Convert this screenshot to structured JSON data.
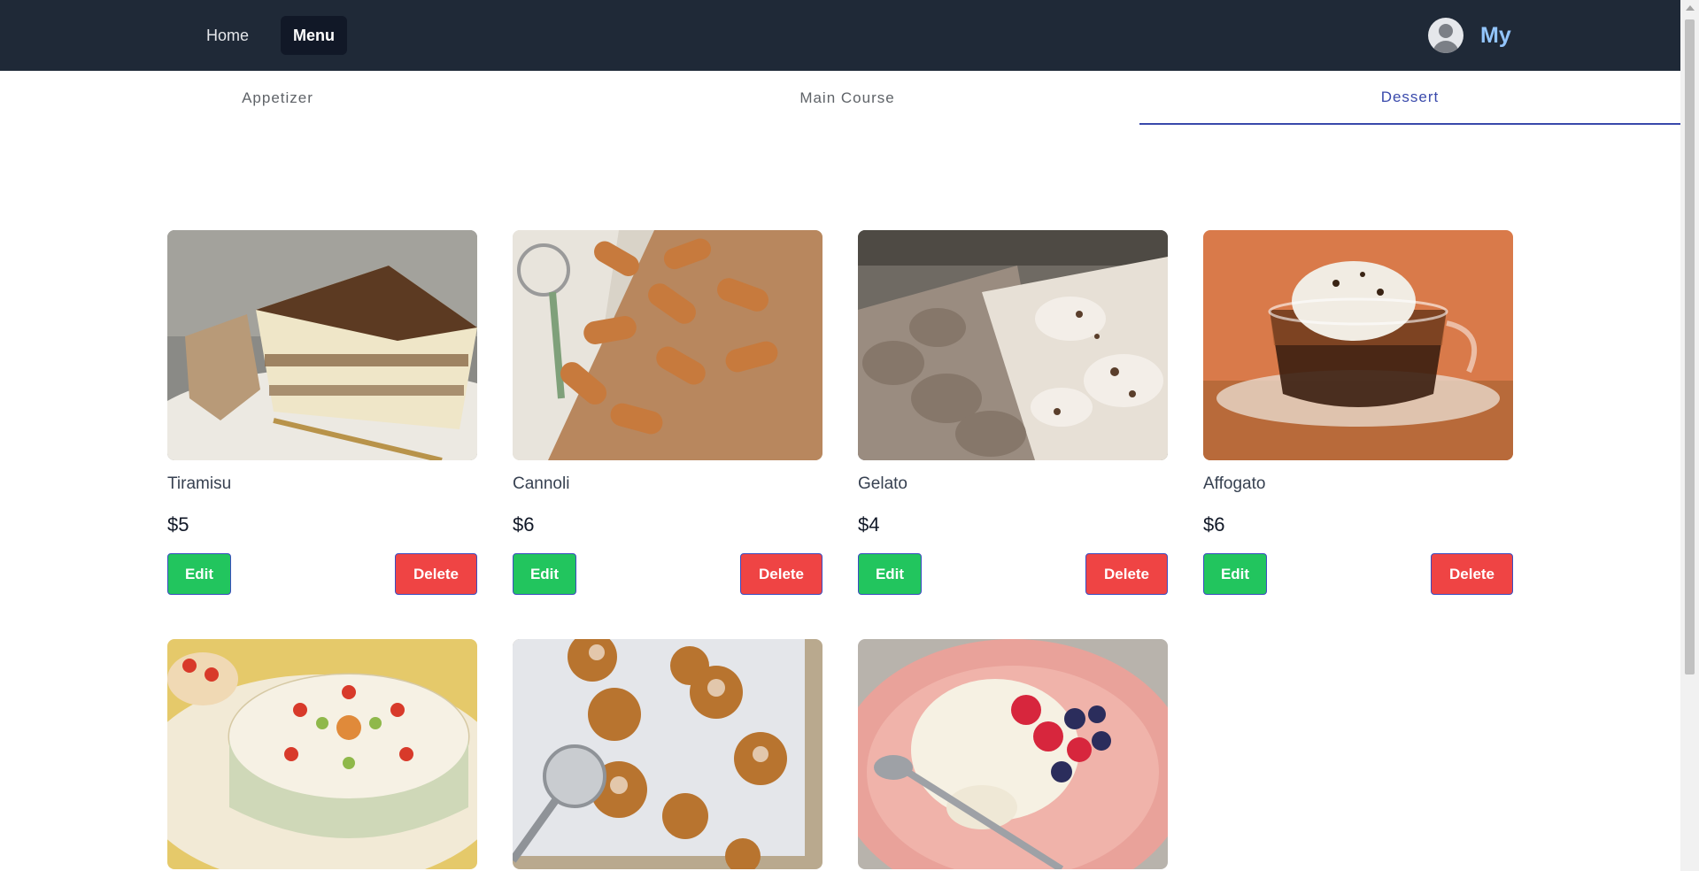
{
  "nav": {
    "home_label": "Home",
    "menu_label": "Menu",
    "user_label": "My"
  },
  "tabs": [
    {
      "label": "Appetizer"
    },
    {
      "label": "Main Course"
    },
    {
      "label": "Dessert",
      "active": true
    }
  ],
  "items": [
    {
      "name": "Tiramisu",
      "price": "$5",
      "edit_label": "Edit",
      "delete_label": "Delete",
      "image": "tiramisu"
    },
    {
      "name": "Cannoli",
      "price": "$6",
      "edit_label": "Edit",
      "delete_label": "Delete",
      "image": "cannoli"
    },
    {
      "name": "Gelato",
      "price": "$4",
      "edit_label": "Edit",
      "delete_label": "Delete",
      "image": "gelato"
    },
    {
      "name": "Affogato",
      "price": "$6",
      "edit_label": "Edit",
      "delete_label": "Delete",
      "image": "affogato"
    },
    {
      "name": "",
      "price": "",
      "image": "cassata"
    },
    {
      "name": "",
      "price": "",
      "image": "zeppole"
    },
    {
      "name": "",
      "price": "",
      "image": "panna-cotta"
    }
  ],
  "colors": {
    "navbar": "#1f2937",
    "active_tab": "#3949ab",
    "edit_button": "#22c55e",
    "delete_button": "#ef4444",
    "user_text": "#93c5fd"
  }
}
